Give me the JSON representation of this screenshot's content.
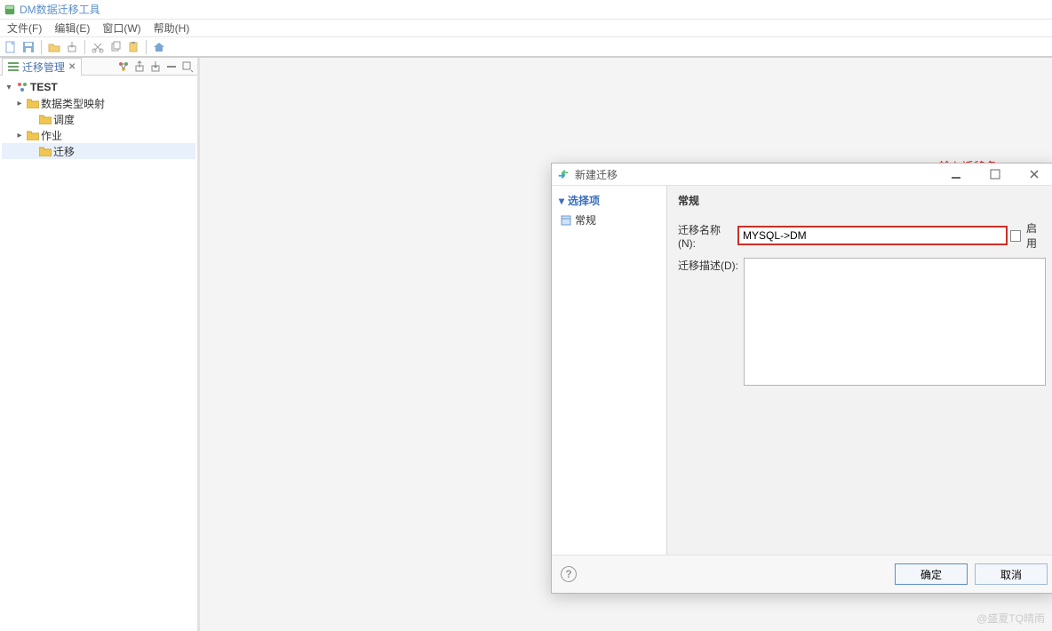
{
  "app": {
    "title": "DM数据迁移工具"
  },
  "menu": {
    "file": "文件(F)",
    "edit": "编辑(E)",
    "window": "窗口(W)",
    "help": "帮助(H)"
  },
  "panel": {
    "tab_label": "迁移管理"
  },
  "tree": {
    "root": "TEST",
    "node_mapping": "数据类型映射",
    "node_schedule": "调度",
    "node_job": "作业",
    "node_migration": "迁移"
  },
  "dialog": {
    "title": "新建迁移",
    "nav_head": "选择项",
    "nav_general": "常规",
    "section_title": "常规",
    "name_label": "迁移名称(N):",
    "name_value": "MYSQL->DM",
    "enable_label": "启用",
    "desc_label": "迁移描述(D):",
    "desc_value": "",
    "ok": "确定",
    "cancel": "取消"
  },
  "annotation": {
    "label": "输入迁移名"
  },
  "watermark": "@盛夏TQ晴雨"
}
